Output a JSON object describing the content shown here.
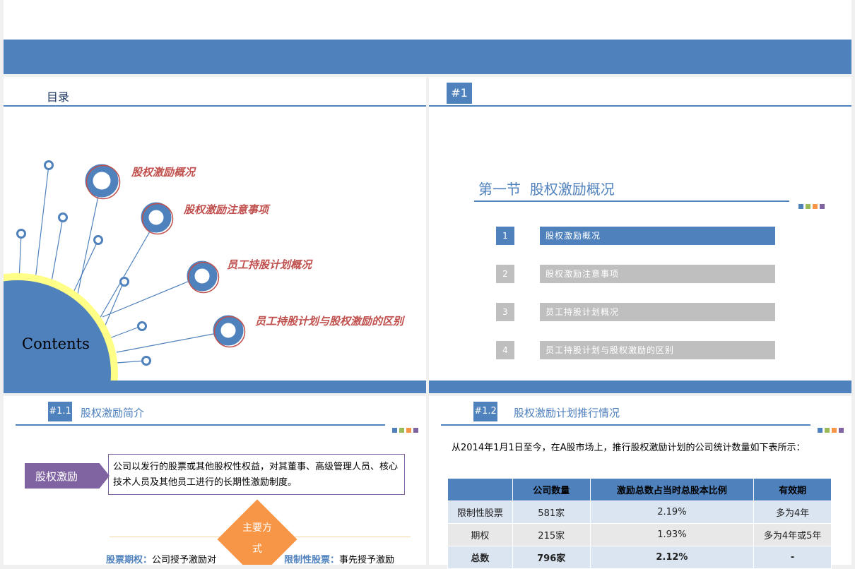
{
  "slide1": {
    "title": "目录",
    "center_label": "Contents",
    "items": [
      "股权激励概况",
      "股权激励注意事项",
      "员工持股计划概况",
      "员工持股计划与股权激励的区别"
    ]
  },
  "slide2": {
    "badge": "#1",
    "heading": "第一节  股权激励概况",
    "items": [
      {
        "num": "1",
        "label": "股权激励概况"
      },
      {
        "num": "2",
        "label": "股权激励注意事项"
      },
      {
        "num": "3",
        "label": "员工持股计划概况"
      },
      {
        "num": "4",
        "label": "员工持股计划与股权激励的区别"
      }
    ]
  },
  "slide3": {
    "badge": "#1.1",
    "title": "股权激励简介",
    "tag": "股权激励",
    "definition": "公司以发行的股票或其他股权性权益，对其董事、高级管理人员、核心技术人员及其他员工进行的长期性激励制度。",
    "diamond": "主要方式",
    "left_term": "股票期权：",
    "left_text": "公司授予激励对",
    "right_term": "限制性股票：",
    "right_text": "事先授予激励"
  },
  "slide4": {
    "badge": "#1.2",
    "title": "股权激励计划推行情况",
    "intro": "从2014年1月1日至今，在A股市场上，推行股权激励计划的公司统计数量如下表所示：",
    "table": {
      "headers": [
        "",
        "公司数量",
        "激励总数占当时总股本比例",
        "有效期"
      ],
      "rows": [
        [
          "限制性股票",
          "581家",
          "2.19%",
          "多为4年"
        ],
        [
          "期权",
          "215家",
          "1.93%",
          "多为4年或5年"
        ],
        [
          "总数",
          "796家",
          "2.12%",
          "-"
        ]
      ]
    }
  },
  "colors": {
    "primary_blue": "#4f81bd",
    "accent_red": "#c0504d",
    "accent_yellow": "#ffff88",
    "purple": "#8064a2",
    "orange": "#f79646",
    "gray_bar": "#bfbfbf"
  }
}
